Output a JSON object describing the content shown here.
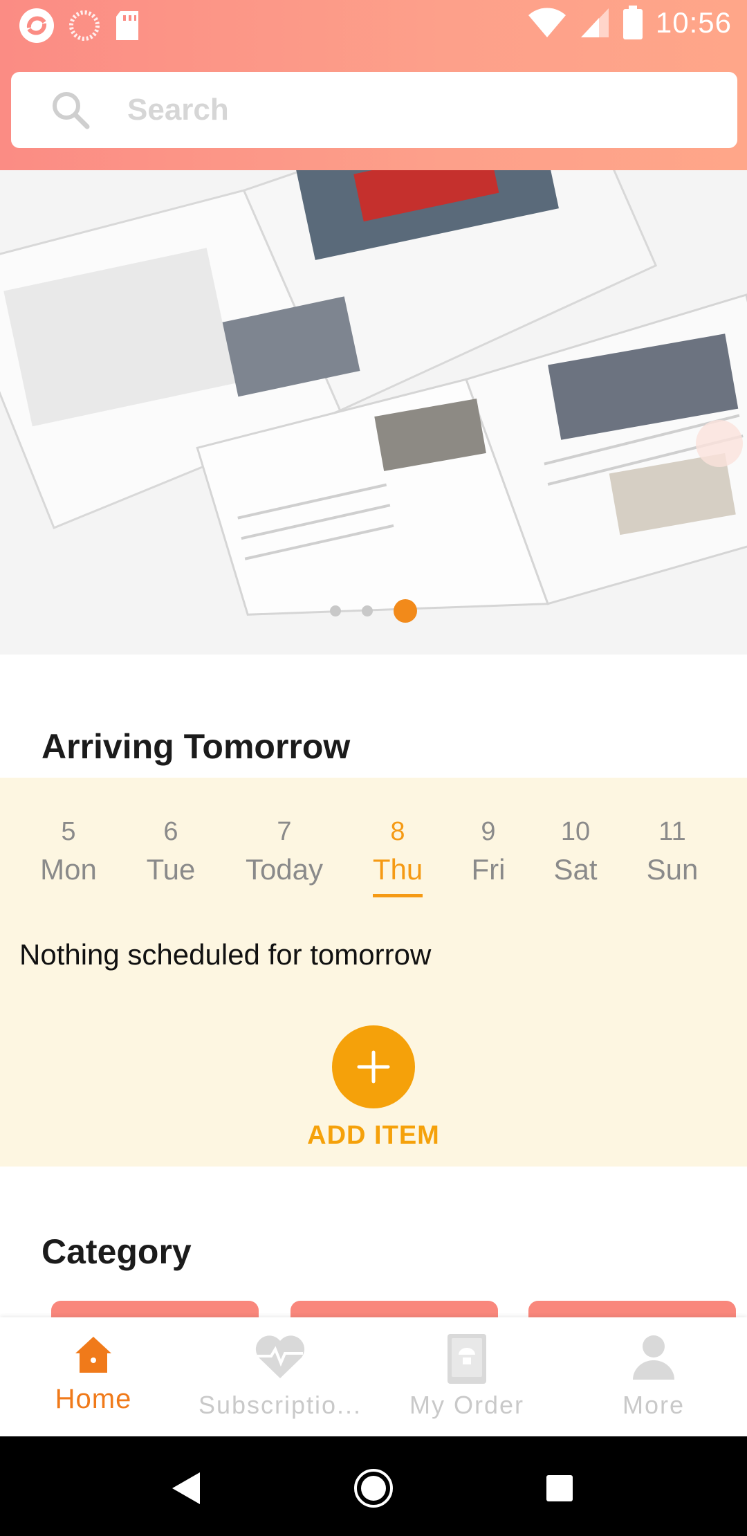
{
  "status_bar": {
    "time": "10:56",
    "left_icons": [
      "app-notification-icon",
      "loading-indicator-icon",
      "sd-card-icon"
    ],
    "right_icons": [
      "wifi-icon",
      "cell-signal-icon",
      "battery-icon"
    ]
  },
  "search": {
    "placeholder": "Search",
    "value": ""
  },
  "banner": {
    "image_icon": "magazine-banner-image",
    "slide_count": 3,
    "active_slide": 3
  },
  "arriving": {
    "title": "Arriving Tomorrow",
    "days": [
      {
        "num": "5",
        "name": "Mon",
        "active": false
      },
      {
        "num": "6",
        "name": "Tue",
        "active": false
      },
      {
        "num": "7",
        "name": "Today",
        "active": false
      },
      {
        "num": "8",
        "name": "Thu",
        "active": true
      },
      {
        "num": "9",
        "name": "Fri",
        "active": false
      },
      {
        "num": "10",
        "name": "Sat",
        "active": false
      },
      {
        "num": "11",
        "name": "Sun",
        "active": false
      }
    ],
    "empty_message": "Nothing scheduled for tomorrow",
    "add_label": "ADD ITEM",
    "accent_color": "#f5a10a",
    "panel_color": "#fdf6e1"
  },
  "category": {
    "title": "Category",
    "card_color": "#f9877c"
  },
  "bottom_nav": {
    "items": [
      {
        "label": "Home",
        "icon": "home-icon",
        "active": true
      },
      {
        "label": "Subscriptio...",
        "icon": "heartbeat-icon",
        "active": false
      },
      {
        "label": "My Order",
        "icon": "order-book-icon",
        "active": false
      },
      {
        "label": "More",
        "icon": "person-icon",
        "active": false
      }
    ],
    "active_color": "#f07a1a"
  },
  "system_nav": {
    "icons": [
      "back-icon",
      "home-circle-icon",
      "recents-icon"
    ]
  }
}
